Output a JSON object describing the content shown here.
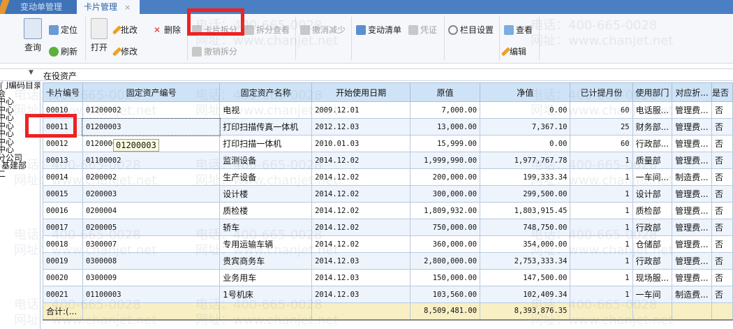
{
  "tabs": [
    {
      "label": "变动单管理",
      "active": false
    },
    {
      "label": "卡片管理",
      "active": true,
      "close": "×"
    }
  ],
  "toolbar": {
    "query": "查询",
    "locate": "定位",
    "refresh": "刷新",
    "open": "打开",
    "approve": "批改",
    "modify": "修改",
    "delete": "删除",
    "card_split": "卡片拆分",
    "split_view": "拆分查看",
    "cancel_split": "撤销拆分",
    "cancel_reduce": "撤消减少",
    "change_list": "变动清单",
    "voucher": "凭证",
    "column_settings": "栏目设置",
    "view": "查看",
    "edit": "编辑"
  },
  "filter": {
    "value": "在役资产"
  },
  "tree": [
    "门编码目录",
    "会",
    "中心",
    "中心",
    "中心",
    "中心",
    "中心",
    "中心",
    "中心",
    "分公司",
    "基建部",
    "二"
  ],
  "table": {
    "headers": [
      "卡片编号",
      "固定资产编号",
      "固定资产名称",
      "开始使用日期",
      "原值",
      "净值",
      "已计提月份",
      "使用部门",
      "对应折...",
      "是否"
    ],
    "rows": [
      [
        "00010",
        "01200002",
        "电视",
        "2009.12.01",
        "7,000.00",
        "0.00",
        "60",
        "电话服...",
        "管理费...",
        "否"
      ],
      [
        "00011",
        "01200003",
        "打印扫描传真一体机",
        "2012.12.03",
        "13,000.00",
        "7,367.10",
        "25",
        "财务部...",
        "管理费...",
        "否"
      ],
      [
        "00012",
        "0120000",
        "打印扫描一体机",
        "2010.01.03",
        "15,999.00",
        "0.00",
        "60",
        "行政部...",
        "管理费...",
        "否"
      ],
      [
        "00013",
        "01100002",
        "监测设备",
        "2014.12.02",
        "1,999,990.00",
        "1,977,767.78",
        "1",
        "质量部",
        "管理费...",
        "否"
      ],
      [
        "00014",
        "0200002",
        "生产设备",
        "2014.12.02",
        "200,000.00",
        "199,333.34",
        "1",
        "一车间...",
        "制造费...",
        "否"
      ],
      [
        "00015",
        "0200003",
        "设计楼",
        "2014.12.02",
        "300,000.00",
        "299,500.00",
        "1",
        "设计部",
        "管理费...",
        "否"
      ],
      [
        "00016",
        "0200004",
        "质检楼",
        "2014.12.02",
        "1,809,932.00",
        "1,803,915.45",
        "1",
        "质检部",
        "管理费...",
        "否"
      ],
      [
        "00017",
        "0200005",
        "轿车",
        "2014.12.02",
        "750,000.00",
        "748,750.00",
        "1",
        "行政部",
        "管理费...",
        "否"
      ],
      [
        "00018",
        "0300007",
        "专用运输车辆",
        "2014.12.02",
        "360,000.00",
        "354,000.00",
        "1",
        "仓储部",
        "管理费...",
        "否"
      ],
      [
        "00019",
        "0300008",
        "贵宾商务车",
        "2014.12.03",
        "2,800,000.00",
        "2,753,333.34",
        "1",
        "行政部",
        "管理费...",
        "否"
      ],
      [
        "00020",
        "0300009",
        "业务用车",
        "2014.12.03",
        "150,000.00",
        "147,500.00",
        "1",
        "现场服...",
        "管理费...",
        "否"
      ],
      [
        "00021",
        "01100003",
        "1号机床",
        "2014.12.03",
        "103,560.00",
        "102,409.34",
        "1",
        "一车间",
        "制造费...",
        "否"
      ]
    ],
    "total": {
      "label": "合计:(...",
      "original": "8,509,481.00",
      "net": "8,393,876.35"
    }
  },
  "tooltip": "01200003",
  "watermark": {
    "phone": "电话：400-665-0028",
    "site": "网址：www.chanjet.net"
  },
  "colors": {
    "tabbar": "#4a7fc3",
    "header": "#cfe3f7",
    "total_row": "#f8efc4",
    "highlight": "#ee2222"
  }
}
